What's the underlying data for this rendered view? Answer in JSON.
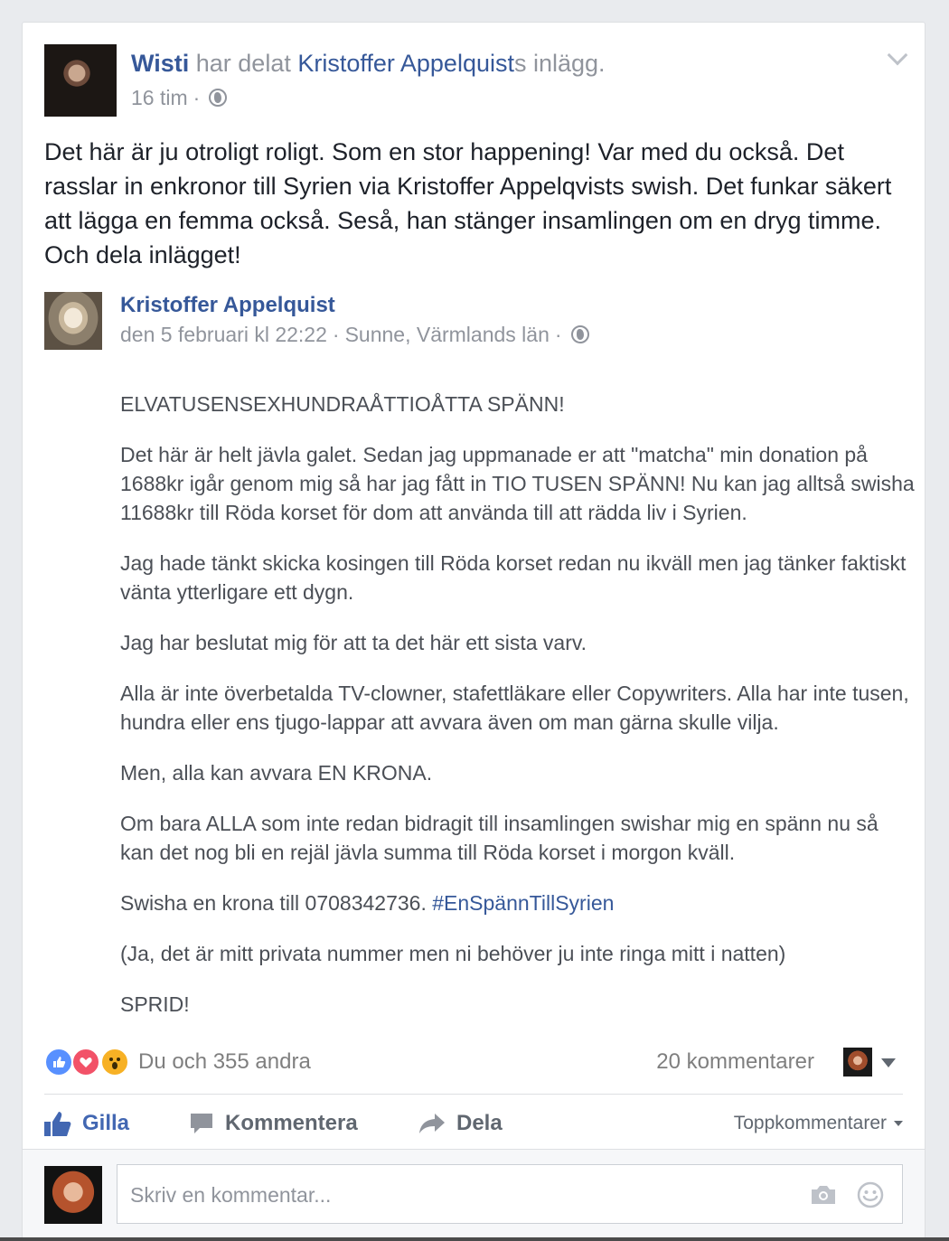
{
  "post": {
    "actor_name": "Wisti",
    "header_middle": " har delat ",
    "shared_owner": "Kristoffer Appelquist",
    "header_suffix": "s inlägg.",
    "time": "16 tim",
    "separator": "·",
    "privacy_icon": "globe-icon",
    "body": "Det här är ju otroligt roligt. Som en stor happening! Var med du också. Det rasslar in enkronor till Syrien via Kristoffer Appelqvists swish. Det funkar säkert att lägga en femma också. Seså, han stänger insamlingen om en dryg timme. Och dela inlägget!"
  },
  "shared": {
    "author": "Kristoffer Appelquist",
    "date": "den 5 februari kl 22:22",
    "separator1": "·",
    "location": "Sunne, Värmlands län",
    "separator2": "·",
    "privacy_icon": "globe-icon",
    "paragraphs": [
      "ELVATUSENSEXHUNDRAÅTTIOÅTTA SPÄNN!",
      "Det här är helt jävla galet. Sedan jag uppmanade er att \"matcha\" min donation på 1688kr igår genom mig så har jag fått in TIO TUSEN SPÄNN! Nu kan jag alltså swisha 11688kr till Röda korset för dom att använda till att rädda liv i Syrien.",
      "Jag hade tänkt skicka kosingen till Röda korset redan nu ikväll men jag tänker faktiskt vänta ytterligare ett dygn.",
      "Jag har beslutat mig för att ta det här ett sista varv.",
      "Alla är inte överbetalda TV-clowner, stafettläkare eller Copywriters. Alla har inte tusen, hundra eller ens tjugo-lappar att avvara även om man gärna skulle vilja.",
      "Men, alla kan avvara EN KRONA.",
      "Om bara ALLA som inte redan bidragit till insamlingen swishar mig en spänn nu så kan det nog bli en rejäl jävla summa till Röda korset i morgon kväll."
    ],
    "swish_text": "Swisha en krona till 0708342736. ",
    "hashtag": "#EnSpännTillSyrien",
    "paragraphs_after": [
      "(Ja, det är mitt privata nummer men ni behöver ju inte ringa mitt i natten)",
      "SPRID!"
    ]
  },
  "reactions": {
    "icons": [
      "like-icon",
      "love-icon",
      "wow-icon"
    ],
    "summary": "Du och 355 andra",
    "comments": "20 kommentarer"
  },
  "actions": {
    "like": "Gilla",
    "comment": "Kommentera",
    "share": "Dela",
    "sort": "Toppkommentarer"
  },
  "comment_input": {
    "placeholder": "Skriv en kommentar..."
  },
  "colors": {
    "link": "#365899",
    "like_active": "#4267b2",
    "meta": "#90949c",
    "background": "#e9ebee"
  }
}
